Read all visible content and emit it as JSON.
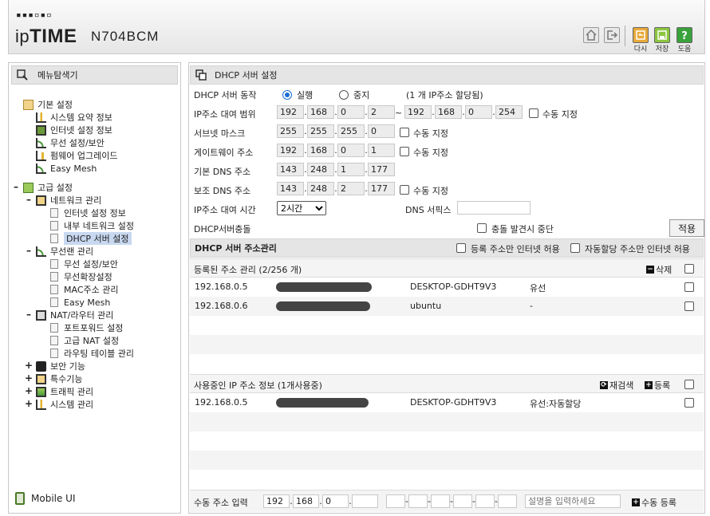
{
  "header": {
    "logo_dots": "▪▪▪▫▪▫",
    "logo_prefix": "ip",
    "logo_bold": "TIME",
    "model": "N704BCM",
    "buttons": [
      {
        "name": "home-icon",
        "label": ""
      },
      {
        "name": "logout-icon",
        "label": ""
      },
      {
        "name": "back-icon",
        "label": "다시"
      },
      {
        "name": "save-icon",
        "label": "저장"
      },
      {
        "name": "help-icon",
        "label": "도움"
      }
    ]
  },
  "left": {
    "title": "메뉴탐색기",
    "basic_group": "기본 설정",
    "basic_items": [
      "시스템 요약 정보",
      "인터넷 설정 정보",
      "무선 설정/보안",
      "펌웨어 업그레이드",
      "Easy Mesh"
    ],
    "advanced_group": "고급 설정",
    "network_group": "네트워크 관리",
    "network_items": [
      "인터넷 설정 정보",
      "내부 네트워크 설정",
      "DHCP 서버 설정"
    ],
    "wireless_group": "무선랜 관리",
    "wireless_items": [
      "무선 설정/보안",
      "무선확장설정",
      "MAC주소 관리",
      "Easy Mesh"
    ],
    "nat_group": "NAT/라우터 관리",
    "nat_items": [
      "포트포워드 설정",
      "고급 NAT 설정",
      "라우팅 테이블 관리"
    ],
    "other_groups": [
      "보안 기능",
      "특수기능",
      "트래픽 관리",
      "시스템 관리"
    ],
    "mobile_label": "Mobile UI"
  },
  "dhcp": {
    "title": "DHCP 서버 설정",
    "op_label": "DHCP 서버 동작",
    "run_label": "실행",
    "stop_label": "중지",
    "alloc_note": "(1 개 IP주소 할당됨)",
    "range_label": "IP주소 대여 범위",
    "range_start": [
      "192",
      "168",
      "0",
      "2"
    ],
    "range_sep": "~",
    "range_end": [
      "192",
      "168",
      "0",
      "254"
    ],
    "manual_label": "수동 지정",
    "subnet_label": "서브넷 마스크",
    "subnet": [
      "255",
      "255",
      "255",
      "0"
    ],
    "gateway_label": "게이트웨이 주소",
    "gateway": [
      "192",
      "168",
      "0",
      "1"
    ],
    "dns1_label": "기본 DNS 주소",
    "dns1": [
      "143",
      "248",
      "1",
      "177"
    ],
    "dns2_label": "보조 DNS 주소",
    "dns2": [
      "143",
      "248",
      "2",
      "177"
    ],
    "lease_label": "IP주소 대여 시간",
    "lease_value": "2시간",
    "dns_suffix_label": "DNS 서픽스",
    "dns_suffix_value": "",
    "conflict_label": "DHCP서버충돌",
    "conflict_stop_label": "충돌 발견시 중단",
    "apply_label": "적용"
  },
  "addr": {
    "title": "DHCP 서버 주소관리",
    "only_reg_label": "등록 주소만 인터넷 허용",
    "auto_only_label": "자동할당 주소만 인터넷 허용",
    "registered_title": "등록된 주소 관리 (2/256 개)",
    "delete_label": "삭제",
    "registered": [
      {
        "ip": "192.168.0.5",
        "host": "DESKTOP-GDHT9V3",
        "type": "유선"
      },
      {
        "ip": "192.168.0.6",
        "host": "ubuntu",
        "type": "-"
      }
    ],
    "inuse_title": "사용중인 IP 주소 정보 (1개사용중)",
    "rescan_label": "재검색",
    "register_label": "등록",
    "inuse": [
      {
        "ip": "192.168.0.5",
        "host": "DESKTOP-GDHT9V3",
        "type": "유선:자동할당"
      }
    ],
    "manual_input_label": "수동 주소 입력",
    "manual_ip": [
      "192",
      "168",
      "0",
      ""
    ],
    "desc_placeholder": "설명을 입력하세요",
    "manual_register_label": "수동 등록"
  }
}
